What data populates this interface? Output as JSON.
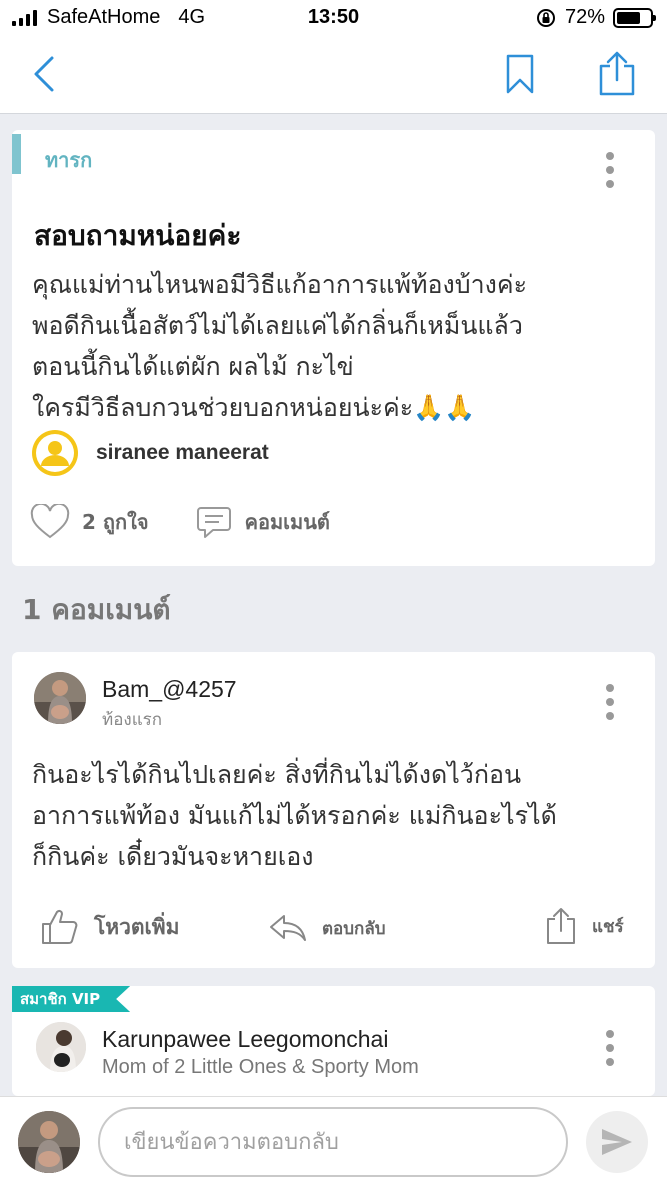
{
  "status_bar": {
    "carrier": "SafeAtHome",
    "network": "4G",
    "time": "13:50",
    "battery_percent_label": "72%",
    "battery_level": 0.72
  },
  "nav": {
    "back_icon": "chevron-left-icon",
    "bookmark_icon": "bookmark-icon",
    "share_icon": "share-icon",
    "accent_color": "#2e8fd8"
  },
  "post": {
    "category": "ทารก",
    "title": "สอบถามหน่อยค่ะ",
    "body": "คุณแม่ท่านไหนพอมีวิธีแก้อาการแพ้ท้องบ้างค่ะ\nพอดีกินเนื้อสัตว์ไม่ได้เลยแค่ได้กลิ่นก็เหม็นแล้ว\nตอนนี้กินได้แต่ผัก ผลไม้ กะไข่\nใครมีวิธีลบกวนช่วยบอกหน่อยน่ะค่ะ🙏🙏",
    "author": "siranee maneerat",
    "likes_label": "2 ถูกใจ",
    "comment_label": "คอมเมนต์"
  },
  "comments_heading": "1 คอมเมนต์",
  "comment": {
    "username": "Bam_@4257",
    "subtitle": "ท้องแรก",
    "body": "กินอะไรได้กินไปเลยค่ะ สิ่งที่กินไม่ได้งดไว้ก่อน\nอาการแพ้ท้อง มันแก้ไม่ได้หรอกค่ะ แม่กินอะไรได้\nก็กินค่ะ เดี๋ยวมันจะหายเอง",
    "vote_label": "โหวตเพิ่ม",
    "reply_label": "ตอบกลับ",
    "share_label": "แชร์"
  },
  "vip_comment": {
    "badge": "สมาชิก VIP",
    "username": "Karunpawee Leegomonchai",
    "subtitle": "Mom of 2 Little Ones & Sporty Mom"
  },
  "reply_bar": {
    "placeholder": "เขียนข้อความตอบกลับ"
  }
}
